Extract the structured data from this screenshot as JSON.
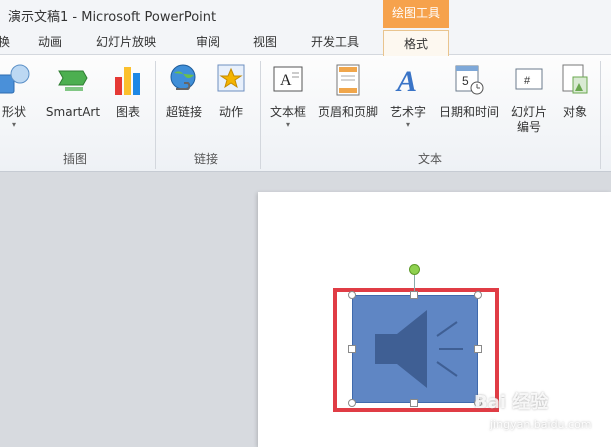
{
  "window": {
    "title": "演示文稿1 - Microsoft PowerPoint",
    "contextual_tab_group": "绘图工具"
  },
  "tabs": [
    {
      "label": "换"
    },
    {
      "label": "动画"
    },
    {
      "label": "幻灯片放映"
    },
    {
      "label": "审阅"
    },
    {
      "label": "视图"
    },
    {
      "label": "开发工具"
    },
    {
      "label": "格式"
    }
  ],
  "ribbon": {
    "groups": [
      {
        "label": "插图",
        "buttons": [
          {
            "label": "形状",
            "icon": "shapes-icon",
            "has_dropdown": true
          },
          {
            "label": "SmartArt",
            "icon": "smartart-icon"
          },
          {
            "label": "图表",
            "icon": "chart-icon"
          }
        ]
      },
      {
        "label": "链接",
        "buttons": [
          {
            "label": "超链接",
            "icon": "hyperlink-globe-icon"
          },
          {
            "label": "动作",
            "icon": "action-star-icon"
          }
        ]
      },
      {
        "label": "文本",
        "buttons": [
          {
            "label": "文本框",
            "icon": "textbox-icon",
            "has_dropdown": true
          },
          {
            "label": "页眉和页脚",
            "icon": "header-footer-icon"
          },
          {
            "label": "艺术字",
            "icon": "wordart-icon",
            "has_dropdown": true
          },
          {
            "label": "日期和时间",
            "icon": "date-time-icon"
          },
          {
            "label": "幻灯片\n编号",
            "icon": "slide-number-icon"
          },
          {
            "label": "对象",
            "icon": "object-icon"
          }
        ]
      }
    ]
  },
  "slide": {
    "selected_shape": {
      "icon": "speaker-icon",
      "fill_color": "#5f86c4"
    },
    "highlight_color": "#e03c45"
  },
  "watermark": {
    "main": "Bai 经验",
    "sub": "jingyan.baidu.com"
  },
  "colors": {
    "contextual_tab": "#f6a24c",
    "ribbon_bg": "#f5f7fa"
  }
}
